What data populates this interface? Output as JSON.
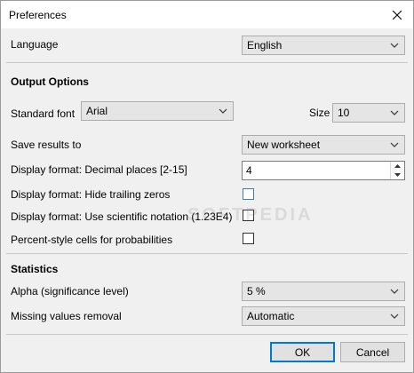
{
  "window": {
    "title": "Preferences"
  },
  "language": {
    "label": "Language",
    "value": "English"
  },
  "output": {
    "header": "Output Options",
    "font_label": "Standard font",
    "font_value": "Arial",
    "size_label": "Size",
    "size_value": "10",
    "save_label": "Save results to",
    "save_value": "New worksheet",
    "decimal_label": "Display format: Decimal places [2-15]",
    "decimal_value": "4",
    "trailing_label": "Display format: Hide trailing zeros",
    "scientific_label": "Display format: Use scientific notation (1.23E4)",
    "percent_label": "Percent-style cells for probabilities"
  },
  "statistics": {
    "header": "Statistics",
    "alpha_label": "Alpha (significance level)",
    "alpha_value": "5 %",
    "missing_label": "Missing values removal",
    "missing_value": "Automatic"
  },
  "footer": {
    "ok_label": "OK",
    "cancel_label": "Cancel"
  },
  "watermark": "SOFTPEDIA"
}
